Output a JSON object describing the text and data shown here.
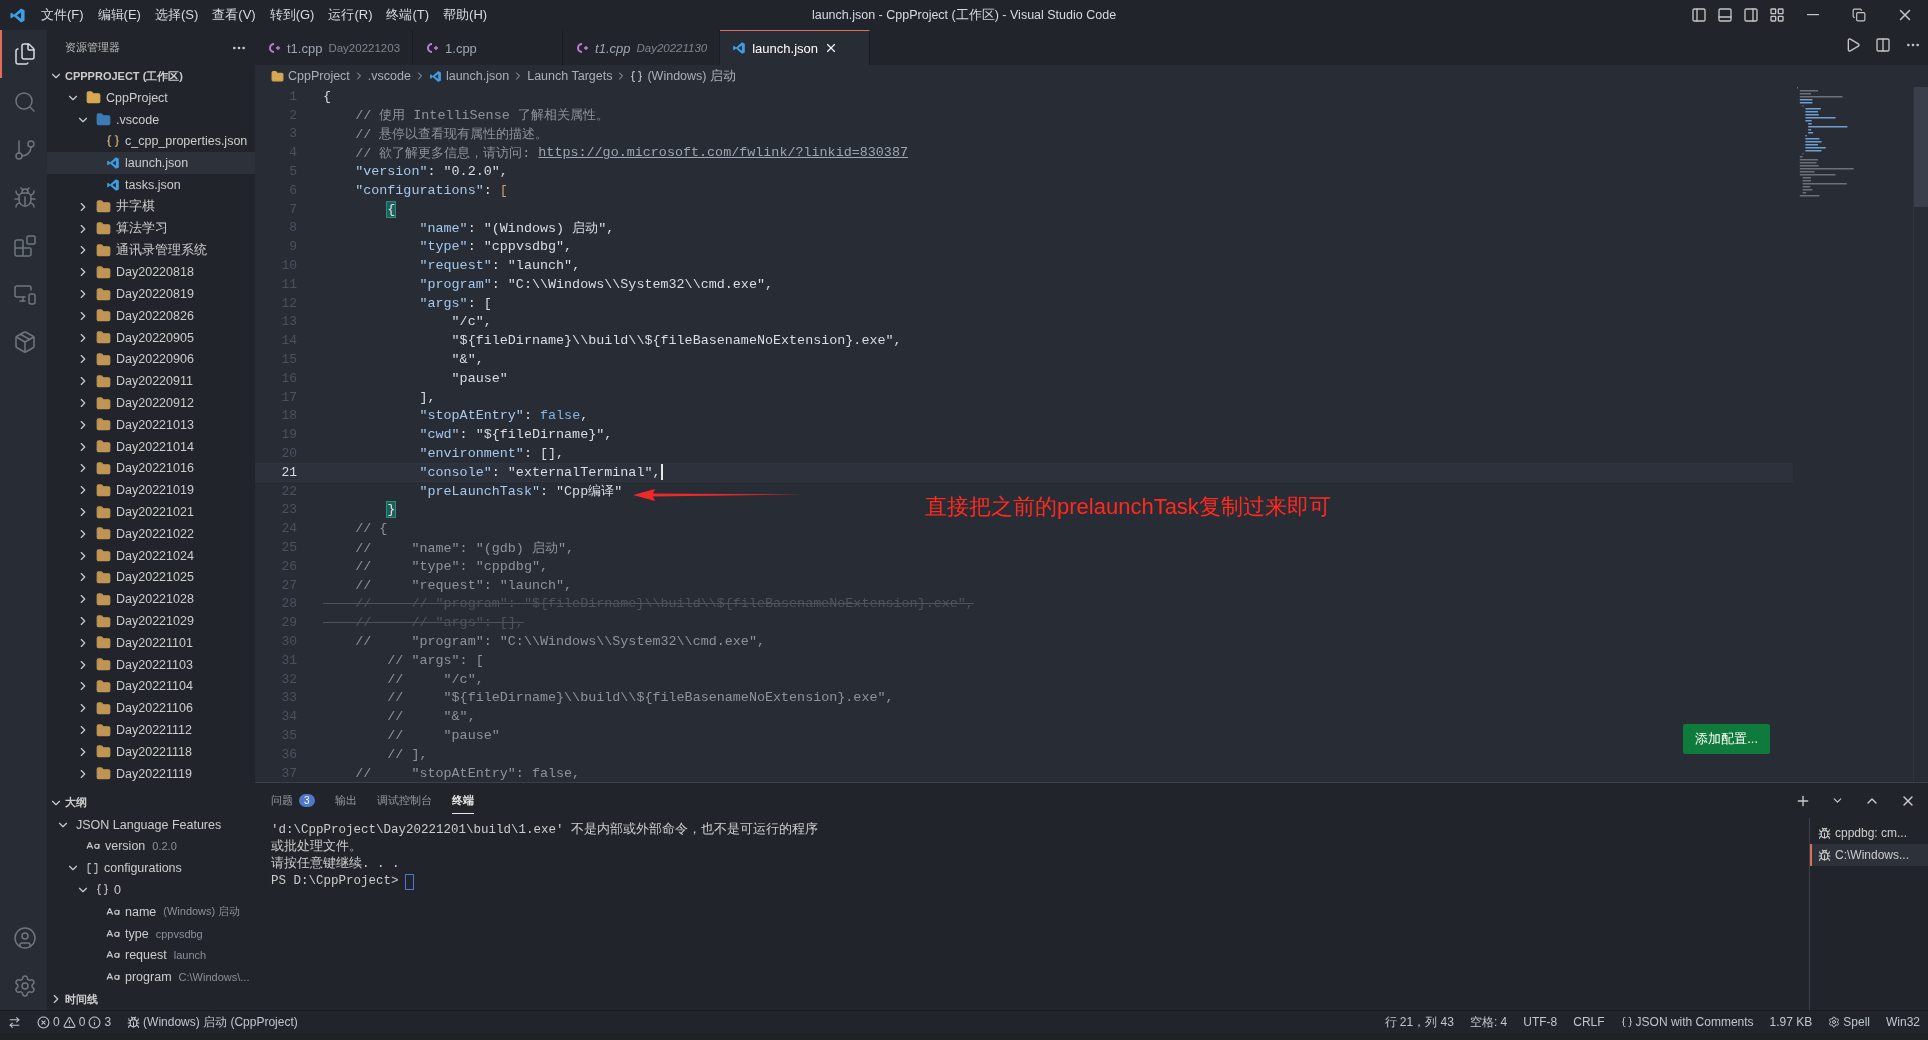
{
  "window": {
    "title": "launch.json - CppProject (工作区) - Visual Studio Code"
  },
  "menu": [
    "文件(F)",
    "编辑(E)",
    "选择(S)",
    "查看(V)",
    "转到(G)",
    "运行(R)",
    "终端(T)",
    "帮助(H)"
  ],
  "activity_bar": [
    {
      "kind": "files",
      "selected": true
    },
    {
      "kind": "search",
      "selected": false
    },
    {
      "kind": "source-control",
      "selected": false
    },
    {
      "kind": "run-debug",
      "selected": false
    },
    {
      "kind": "extensions",
      "selected": false
    },
    {
      "kind": "remote",
      "selected": false
    },
    {
      "kind": "package",
      "selected": false
    }
  ],
  "explorer": {
    "title": "资源管理器",
    "workspace": {
      "label": "CPPPROJECT (工作区)",
      "expanded": true,
      "items": [
        {
          "name": "CppProject",
          "kind": "project-folder",
          "expanded": true,
          "selected": false,
          "children": [
            {
              "name": ".vscode",
              "kind": "vscode-folder",
              "expanded": true,
              "selected": false,
              "children": [
                {
                  "name": "c_cpp_properties.json",
                  "kind": "json",
                  "selected": false
                },
                {
                  "name": "launch.json",
                  "kind": "vscode-json",
                  "selected": true
                },
                {
                  "name": "tasks.json",
                  "kind": "vscode-json",
                  "selected": false
                }
              ]
            },
            {
              "name": "井字棋",
              "kind": "folder",
              "expanded": false,
              "selected": false
            },
            {
              "name": "算法学习",
              "kind": "folder",
              "expanded": false,
              "selected": false
            },
            {
              "name": "通讯录管理系统",
              "kind": "folder",
              "expanded": false,
              "selected": false
            },
            {
              "name": "Day20220818",
              "kind": "folder",
              "expanded": false,
              "selected": false
            },
            {
              "name": "Day20220819",
              "kind": "folder",
              "expanded": false,
              "selected": false
            },
            {
              "name": "Day20220826",
              "kind": "folder",
              "expanded": false,
              "selected": false
            },
            {
              "name": "Day20220905",
              "kind": "folder",
              "expanded": false,
              "selected": false
            },
            {
              "name": "Day20220906",
              "kind": "folder",
              "expanded": false,
              "selected": false
            },
            {
              "name": "Day20220911",
              "kind": "folder",
              "expanded": false,
              "selected": false
            },
            {
              "name": "Day20220912",
              "kind": "folder",
              "expanded": false,
              "selected": false
            },
            {
              "name": "Day20221013",
              "kind": "folder",
              "expanded": false,
              "selected": false
            },
            {
              "name": "Day20221014",
              "kind": "folder",
              "expanded": false,
              "selected": false
            },
            {
              "name": "Day20221016",
              "kind": "folder",
              "expanded": false,
              "selected": false
            },
            {
              "name": "Day20221019",
              "kind": "folder",
              "expanded": false,
              "selected": false
            },
            {
              "name": "Day20221021",
              "kind": "folder",
              "expanded": false,
              "selected": false
            },
            {
              "name": "Day20221022",
              "kind": "folder",
              "expanded": false,
              "selected": false
            },
            {
              "name": "Day20221024",
              "kind": "folder",
              "expanded": false,
              "selected": false
            },
            {
              "name": "Day20221025",
              "kind": "folder",
              "expanded": false,
              "selected": false
            },
            {
              "name": "Day20221028",
              "kind": "folder",
              "expanded": false,
              "selected": false
            },
            {
              "name": "Day20221029",
              "kind": "folder",
              "expanded": false,
              "selected": false
            },
            {
              "name": "Day20221101",
              "kind": "folder",
              "expanded": false,
              "selected": false
            },
            {
              "name": "Day20221103",
              "kind": "folder",
              "expanded": false,
              "selected": false
            },
            {
              "name": "Day20221104",
              "kind": "folder",
              "expanded": false,
              "selected": false
            },
            {
              "name": "Day20221106",
              "kind": "folder",
              "expanded": false,
              "selected": false
            },
            {
              "name": "Day20221112",
              "kind": "folder",
              "expanded": false,
              "selected": false
            },
            {
              "name": "Day20221118",
              "kind": "folder",
              "expanded": false,
              "selected": false
            },
            {
              "name": "Day20221119",
              "kind": "folder",
              "expanded": false,
              "selected": false
            }
          ]
        }
      ]
    }
  },
  "outline": {
    "title": "大纲",
    "expanded": true,
    "items": [
      {
        "label": "JSON Language Features",
        "expanded": true,
        "children": [
          {
            "label": "version",
            "detail": "0.2.0",
            "kind": "string"
          },
          {
            "label": "configurations",
            "kind": "array",
            "expanded": true,
            "children": [
              {
                "label": "0",
                "kind": "object",
                "expanded": true,
                "children": [
                  {
                    "label": "name",
                    "detail": "(Windows) 启动",
                    "kind": "string"
                  },
                  {
                    "label": "type",
                    "detail": "cppvsdbg",
                    "kind": "string"
                  },
                  {
                    "label": "request",
                    "detail": "launch",
                    "kind": "string"
                  },
                  {
                    "label": "program",
                    "detail": "C:\\Windows\\...",
                    "kind": "string"
                  }
                ]
              }
            ]
          }
        ]
      }
    ]
  },
  "timeline": {
    "title": "时间线",
    "expanded": false
  },
  "tabs": [
    {
      "name": "t1.cpp",
      "description": "Day20221203",
      "kind": "cpp",
      "preview": false,
      "selected": false
    },
    {
      "name": "1.cpp",
      "kind": "cpp",
      "preview": false,
      "selected": false
    },
    {
      "name": "t1.cpp",
      "description": "Day20221130",
      "kind": "cpp",
      "preview": true,
      "selected": false
    },
    {
      "name": "launch.json",
      "kind": "vscode-json",
      "preview": false,
      "selected": true
    }
  ],
  "breadcrumbs": [
    {
      "label": "CppProject",
      "kind": "folder"
    },
    {
      "label": ".vscode",
      "kind": "plain"
    },
    {
      "label": "launch.json",
      "kind": "vscode-json"
    },
    {
      "label": "Launch Targets",
      "kind": "plain"
    },
    {
      "label": "(Windows) 启动",
      "kind": "object"
    }
  ],
  "editor": {
    "lines": [
      {
        "n": "1",
        "active": false,
        "tokens": [
          {
            "kind": "punct",
            "text": "{"
          }
        ]
      },
      {
        "n": "2",
        "active": false,
        "tokens": [
          {
            "kind": "comment",
            "text": "    // 使用 IntelliSense 了解相关属性。"
          }
        ]
      },
      {
        "n": "3",
        "active": false,
        "tokens": [
          {
            "kind": "comment",
            "text": "    // 悬停以查看现有属性的描述。"
          }
        ]
      },
      {
        "n": "4",
        "active": false,
        "tokens": [
          {
            "kind": "comment",
            "text": "    // 欲了解更多信息，请访问: "
          },
          {
            "kind": "link",
            "text": "https://go.microsoft.com/fwlink/?linkid=830387"
          }
        ]
      },
      {
        "n": "5",
        "active": false,
        "tokens": [
          {
            "kind": "key",
            "text": "    \"version\""
          },
          {
            "kind": "punct",
            "text": ": "
          },
          {
            "kind": "string",
            "text": "\"0.2.0\""
          },
          {
            "kind": "punct",
            "text": ","
          }
        ]
      },
      {
        "n": "6",
        "active": false,
        "tokens": [
          {
            "kind": "key",
            "text": "    \"configurations\""
          },
          {
            "kind": "punct",
            "text": ": "
          },
          {
            "kind": "bracket",
            "text": "["
          }
        ]
      },
      {
        "n": "7",
        "active": false,
        "tokens": [
          {
            "kind": "match",
            "text": "        {"
          }
        ]
      },
      {
        "n": "8",
        "active": false,
        "tokens": [
          {
            "kind": "key",
            "text": "            \"name\""
          },
          {
            "kind": "punct",
            "text": ": "
          },
          {
            "kind": "string",
            "text": "\"(Windows) 启动\""
          },
          {
            "kind": "punct",
            "text": ","
          }
        ]
      },
      {
        "n": "9",
        "active": false,
        "tokens": [
          {
            "kind": "key",
            "text": "            \"type\""
          },
          {
            "kind": "punct",
            "text": ": "
          },
          {
            "kind": "string",
            "text": "\"cppvsdbg\""
          },
          {
            "kind": "punct",
            "text": ","
          }
        ]
      },
      {
        "n": "10",
        "active": false,
        "tokens": [
          {
            "kind": "key",
            "text": "            \"request\""
          },
          {
            "kind": "punct",
            "text": ": "
          },
          {
            "kind": "string",
            "text": "\"launch\""
          },
          {
            "kind": "punct",
            "text": ","
          }
        ]
      },
      {
        "n": "11",
        "active": false,
        "tokens": [
          {
            "kind": "key",
            "text": "            \"program\""
          },
          {
            "kind": "punct",
            "text": ": "
          },
          {
            "kind": "string",
            "text": "\"C:\\\\Windows\\\\System32\\\\cmd.exe\""
          },
          {
            "kind": "punct",
            "text": ","
          }
        ]
      },
      {
        "n": "12",
        "active": false,
        "tokens": [
          {
            "kind": "key",
            "text": "            \"args\""
          },
          {
            "kind": "punct",
            "text": ": ["
          }
        ]
      },
      {
        "n": "13",
        "active": false,
        "tokens": [
          {
            "kind": "string",
            "text": "                \"/c\""
          },
          {
            "kind": "punct",
            "text": ","
          }
        ]
      },
      {
        "n": "14",
        "active": false,
        "tokens": [
          {
            "kind": "string",
            "text": "                \"${fileDirname}\\\\build\\\\${fileBasenameNoExtension}.exe\""
          },
          {
            "kind": "punct",
            "text": ","
          }
        ]
      },
      {
        "n": "15",
        "active": false,
        "tokens": [
          {
            "kind": "string",
            "text": "                \"&\""
          },
          {
            "kind": "punct",
            "text": ","
          }
        ]
      },
      {
        "n": "16",
        "active": false,
        "tokens": [
          {
            "kind": "string",
            "text": "                \"pause\""
          }
        ]
      },
      {
        "n": "17",
        "active": false,
        "tokens": [
          {
            "kind": "punct",
            "text": "            ],"
          }
        ]
      },
      {
        "n": "18",
        "active": false,
        "tokens": [
          {
            "kind": "key",
            "text": "            \"stopAtEntry\""
          },
          {
            "kind": "punct",
            "text": ": "
          },
          {
            "kind": "keyword",
            "text": "false"
          },
          {
            "kind": "punct",
            "text": ","
          }
        ]
      },
      {
        "n": "19",
        "active": false,
        "tokens": [
          {
            "kind": "key",
            "text": "            \"cwd\""
          },
          {
            "kind": "punct",
            "text": ": "
          },
          {
            "kind": "string",
            "text": "\"${fileDirname}\""
          },
          {
            "kind": "punct",
            "text": ","
          }
        ]
      },
      {
        "n": "20",
        "active": false,
        "tokens": [
          {
            "kind": "key",
            "text": "            \"environment\""
          },
          {
            "kind": "punct",
            "text": ": [],"
          }
        ]
      },
      {
        "n": "21",
        "active": true,
        "tokens": [
          {
            "kind": "key",
            "text": "            \"console\""
          },
          {
            "kind": "punct",
            "text": ": "
          },
          {
            "kind": "string",
            "text": "\"externalTerminal\""
          },
          {
            "kind": "punct",
            "text": ","
          }
        ]
      },
      {
        "n": "22",
        "active": false,
        "tokens": [
          {
            "kind": "key",
            "text": "            \"preLaunchTask\""
          },
          {
            "kind": "punct",
            "text": ": "
          },
          {
            "kind": "string",
            "text": "\"Cpp编译\""
          }
        ]
      },
      {
        "n": "23",
        "active": false,
        "tokens": [
          {
            "kind": "match",
            "text": "        }"
          }
        ]
      },
      {
        "n": "24",
        "active": false,
        "tokens": [
          {
            "kind": "comment",
            "text": "    // {"
          }
        ]
      },
      {
        "n": "25",
        "active": false,
        "tokens": [
          {
            "kind": "comment",
            "text": "    //     \"name\": \"(gdb) 启动\","
          }
        ]
      },
      {
        "n": "26",
        "active": false,
        "tokens": [
          {
            "kind": "comment",
            "text": "    //     \"type\": \"cppdbg\","
          }
        ]
      },
      {
        "n": "27",
        "active": false,
        "tokens": [
          {
            "kind": "comment",
            "text": "    //     \"request\": \"launch\","
          }
        ]
      },
      {
        "n": "28",
        "active": false,
        "tokens": [
          {
            "kind": "strike",
            "text": "    //     // \"program\": \"${fileDirname}\\\\build\\\\${fileBasenameNoExtension}.exe\","
          }
        ]
      },
      {
        "n": "29",
        "active": false,
        "tokens": [
          {
            "kind": "strike",
            "text": "    //     // \"args\": [],"
          }
        ]
      },
      {
        "n": "30",
        "active": false,
        "tokens": [
          {
            "kind": "comment",
            "text": "    //     \"program\": \"C:\\\\Windows\\\\System32\\\\cmd.exe\","
          }
        ]
      },
      {
        "n": "31",
        "active": false,
        "tokens": [
          {
            "kind": "comment",
            "text": "        // \"args\": ["
          }
        ]
      },
      {
        "n": "32",
        "active": false,
        "tokens": [
          {
            "kind": "comment",
            "text": "        //     \"/c\","
          }
        ]
      },
      {
        "n": "33",
        "active": false,
        "tokens": [
          {
            "kind": "comment",
            "text": "        //     \"${fileDirname}\\\\build\\\\${fileBasenameNoExtension}.exe\","
          }
        ]
      },
      {
        "n": "34",
        "active": false,
        "tokens": [
          {
            "kind": "comment",
            "text": "        //     \"&\","
          }
        ]
      },
      {
        "n": "35",
        "active": false,
        "tokens": [
          {
            "kind": "comment",
            "text": "        //     \"pause\""
          }
        ]
      },
      {
        "n": "36",
        "active": false,
        "tokens": [
          {
            "kind": "comment",
            "text": "        // ],"
          }
        ]
      },
      {
        "n": "37",
        "active": false,
        "tokens": [
          {
            "kind": "comment",
            "text": "    //     \"stopAtEntry\": false,"
          }
        ]
      }
    ],
    "annotation": {
      "text": "直接把之前的prelaunchTask复制过来即可"
    },
    "add_config_button": "添加配置..."
  },
  "panel": {
    "tabs": [
      {
        "label": "问题",
        "badge": "3",
        "selected": false
      },
      {
        "label": "输出",
        "selected": false
      },
      {
        "label": "调试控制台",
        "selected": false
      },
      {
        "label": "终端",
        "selected": true
      }
    ],
    "terminal_lines": [
      "'d:\\CppProject\\Day20221201\\build\\1.exe' 不是内部或外部命令，也不是可运行的程序",
      "或批处理文件。",
      "请按任意键继续. . ."
    ],
    "prompt": "PS D:\\CppProject>",
    "terminals": [
      {
        "label": "cppdbg: cm...",
        "selected": false
      },
      {
        "label": "C:\\Windows...",
        "selected": true
      }
    ]
  },
  "status_bar": {
    "errors": "0",
    "warnings": "0",
    "infos": "3",
    "launch": "(Windows) 启动 (CppProject)",
    "items": [
      {
        "kind": "text",
        "text": "行 21，列 43"
      },
      {
        "kind": "text",
        "text": "空格: 4"
      },
      {
        "kind": "text",
        "text": "UTF-8"
      },
      {
        "kind": "text",
        "text": "CRLF"
      },
      {
        "kind": "language",
        "text": "JSON with Comments"
      },
      {
        "kind": "text",
        "text": "1.97 KB"
      },
      {
        "kind": "spell",
        "text": "Spell"
      },
      {
        "kind": "text",
        "text": "Win32"
      }
    ]
  }
}
